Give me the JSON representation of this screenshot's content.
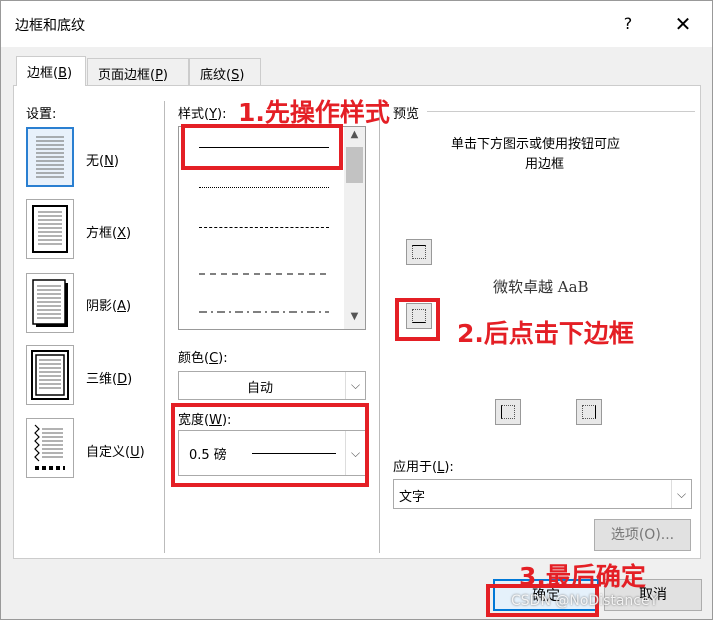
{
  "dialog": {
    "title": "边框和底纹",
    "help": "?",
    "close": "✕"
  },
  "tabs": [
    {
      "label": "边框(",
      "key": "B",
      "suffix": ")"
    },
    {
      "label": "页面边框(",
      "key": "P",
      "suffix": ")"
    },
    {
      "label": "底纹(",
      "key": "S",
      "suffix": ")"
    }
  ],
  "settings": {
    "header": "设置:",
    "items": [
      {
        "label": "无(",
        "key": "N",
        "suffix": ")"
      },
      {
        "label": "方框(",
        "key": "X",
        "suffix": ")"
      },
      {
        "label": "阴影(",
        "key": "A",
        "suffix": ")"
      },
      {
        "label": "三维(",
        "key": "D",
        "suffix": ")"
      },
      {
        "label": "自定义(",
        "key": "U",
        "suffix": ")"
      }
    ]
  },
  "style": {
    "label": "样式(",
    "key": "Y",
    "suffix": "):"
  },
  "color": {
    "label": "颜色(",
    "key": "C",
    "suffix": "):",
    "value": "自动"
  },
  "width": {
    "label": "宽度(",
    "key": "W",
    "suffix": "):",
    "value": "0.5 磅"
  },
  "preview": {
    "header": "预览",
    "hint_line1": "单击下方图示或使用按钮可应",
    "hint_line2": "用边框",
    "sample_text": "微软卓越  AaB"
  },
  "apply_to": {
    "label": "应用于(",
    "key": "L",
    "suffix": "):",
    "value": "文字"
  },
  "buttons": {
    "options": "选项(O)...",
    "ok": "确定",
    "cancel": "取消"
  },
  "annotations": {
    "step1": "1.先操作样式",
    "step2": "2.后点击下边框",
    "step3": "3.最后确定",
    "accent": "#e41f25"
  },
  "watermark": "CSDN @NoDistanceY"
}
